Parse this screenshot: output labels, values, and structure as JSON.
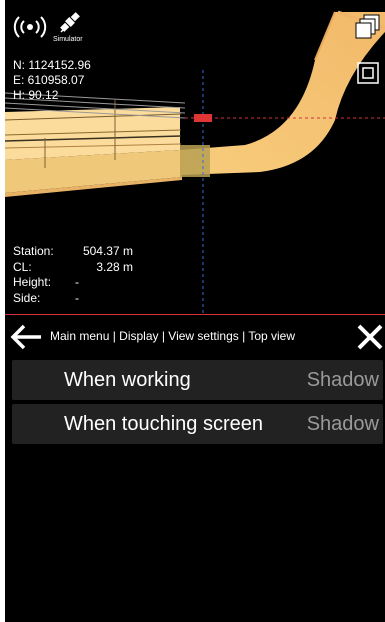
{
  "viewport": {
    "status": {
      "simulator_label": "Simulator"
    },
    "coordinates": {
      "northing": "N: 1124152.96",
      "easting": "E: 610958.07",
      "height": "H: 90.12"
    },
    "station_info": [
      {
        "label": "Station:",
        "value": "504.37 m"
      },
      {
        "label": "CL:",
        "value": "3.28 m"
      },
      {
        "label": "Height:",
        "value": "-"
      },
      {
        "label": "Side:",
        "value": "-"
      }
    ]
  },
  "breadcrumb": {
    "text": "Main menu | Display | View settings | Top view"
  },
  "settings": [
    {
      "label": "When working",
      "value": "Shadow"
    },
    {
      "label": "When touching screen",
      "value": "Shadow"
    }
  ],
  "colors": {
    "road": "#f5c672",
    "accent_red": "#d6323e",
    "row_bg": "#222222",
    "value_text": "#9a9a9a"
  },
  "icons": [
    "gps-signal-icon",
    "satellite-icon",
    "layers-icon",
    "frame-icon",
    "back-arrow-icon",
    "close-icon"
  ]
}
